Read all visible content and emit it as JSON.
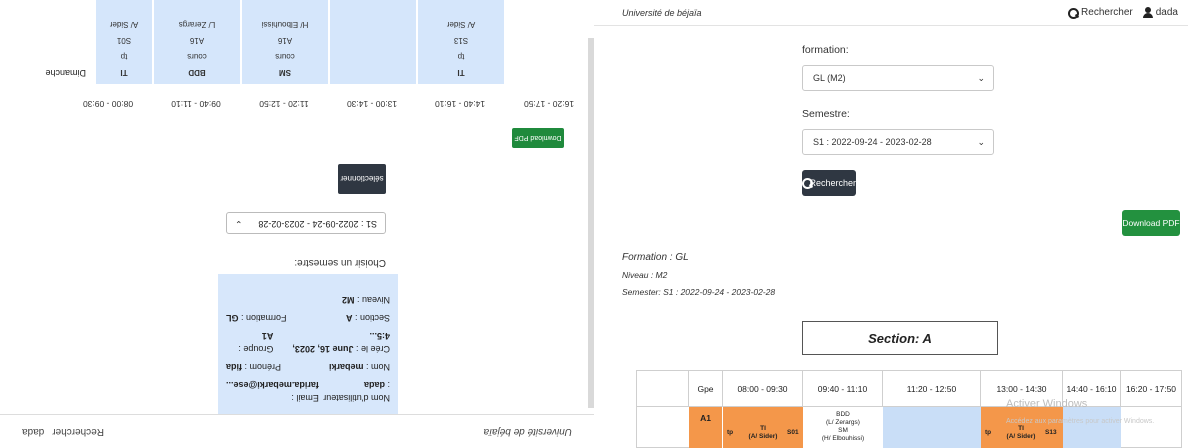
{
  "left": {
    "nav": {
      "brand": "Université de béjaïa",
      "search": "Rechercher",
      "user": "dada"
    },
    "user_card": {
      "username_label": "Nom d'utilisateur :",
      "username": "dada",
      "email_label": "Email :",
      "email": "farida.mebarki@ese...",
      "nom_label": "Nom :",
      "nom": "mebarki",
      "prenom_label": "Prénom :",
      "prenom": "fida",
      "created_label": "Crée le :",
      "created": "June 16, 2023, 4:5...",
      "groupe_label": "Groupe :",
      "groupe": "A1",
      "section_label": "Section :",
      "section": "A",
      "formation_label": "Formation :",
      "formation": "GL",
      "niveau_label": "Niveau :",
      "niveau": "M2"
    },
    "semester_label": "Choisir un semestre:",
    "semester_value": "S1 : 2022-09-24 - 2023-02-28",
    "select_button": "sélectionner",
    "download": "Download PDF",
    "times": [
      "16:20 - 17:50",
      "14:40 - 16:10",
      "13:00 - 14:30",
      "11:20 - 12:50",
      "09:40 - 11:10",
      "08:00 - 09:30"
    ],
    "day": "Dimanche",
    "cells": [
      {
        "l1": "TI",
        "l2": "tp",
        "l3": "S13",
        "l4": "A/ Sider"
      },
      {
        "l1": "",
        "l2": "",
        "l3": "",
        "l4": ""
      },
      {
        "l1": "SM",
        "l2": "cours",
        "l3": "A16",
        "l4": "H/ Elbouhissi"
      },
      {
        "l1": "BDD",
        "l2": "cours",
        "l3": "A16",
        "l4": "L/ Zerargs"
      },
      {
        "l1": "TI",
        "l2": "tp",
        "l3": "S01",
        "l4": "A/ Sider"
      }
    ]
  },
  "right": {
    "nav": {
      "brand": "Université de béjaïa",
      "search": "Rechercher",
      "user": "dada"
    },
    "formation_label": "formation:",
    "formation_value": "GL (M2)",
    "semestre_label": "Semestre:",
    "semestre_value": "S1 : 2022-09-24 - 2023-02-28",
    "search_button": "Rechercher",
    "download": "Download PDF",
    "info": {
      "formation": "Formation : GL",
      "niveau": "Niveau : M2",
      "semester": "Semester: S1 : 2022-09-24 - 2023-02-28"
    },
    "section_title": "Section: A",
    "table": {
      "headers": [
        "",
        "Gpe",
        "08:00 - 09:30",
        "09:40 - 11:10",
        "11:20 - 12:50",
        "13:00 - 14:30",
        "14:40 - 16:10",
        "16:20 - 17:50"
      ],
      "row": {
        "gpe": "A1",
        "s1": {
          "type": "tp",
          "module": "TI",
          "teacher": "(A/ Sider)",
          "room": "S01"
        },
        "s2": {
          "module": "BDD",
          "teacher1": "(L/ Zerargs)",
          "module2": "SM",
          "teacher2": "(H/ Elbouhissi)"
        },
        "s4": {
          "type": "tp",
          "module": "TI",
          "teacher": "(A/ Sider)",
          "room": "S13"
        }
      }
    },
    "watermark": "Activer Windows",
    "watermark_sub": "Accédez aux paramètres pour activer Windows."
  }
}
